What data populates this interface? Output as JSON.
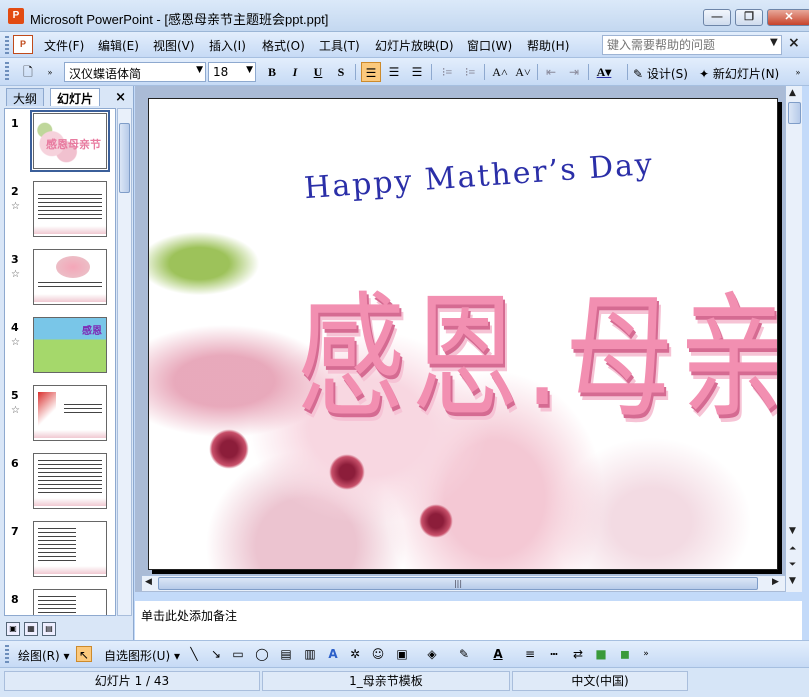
{
  "window": {
    "app_icon": "P",
    "title": "Microsoft PowerPoint - [感恩母亲节主题班会ppt.ppt]",
    "minimize": "—",
    "restore": "❐",
    "close": "✕"
  },
  "menu": {
    "doc_icon": "P",
    "items": [
      "文件(F)",
      "编辑(E)",
      "视图(V)",
      "插入(I)",
      "格式(O)",
      "工具(T)",
      "幻灯片放映(D)",
      "窗口(W)",
      "帮助(H)"
    ],
    "help_placeholder": "键入需要帮助的问题",
    "help_arrow": "▼",
    "close_doc": "×"
  },
  "toolbar": {
    "font_name": "汉仪蝶语体简",
    "font_size": "18",
    "bold": "B",
    "italic": "I",
    "underline": "U",
    "shadow": "S",
    "design_label": "设计(S)",
    "new_slide_label": "新幻灯片(N)"
  },
  "left_panel": {
    "tab_outline": "大纲",
    "tab_slides": "幻灯片",
    "close": "×",
    "thumbnails": [
      {
        "num": "1",
        "star": "",
        "label": "感恩母亲节"
      },
      {
        "num": "2",
        "star": "☆"
      },
      {
        "num": "3",
        "star": "☆"
      },
      {
        "num": "4",
        "star": "☆",
        "label": "感恩"
      },
      {
        "num": "5",
        "star": "☆"
      },
      {
        "num": "6",
        "star": ""
      },
      {
        "num": "7",
        "star": ""
      },
      {
        "num": "8",
        "star": ""
      }
    ]
  },
  "slide": {
    "subtitle": "Happy Mather’s Day",
    "title": "感恩.母亲节"
  },
  "notes": {
    "placeholder": "单击此处添加备注"
  },
  "draw_toolbar": {
    "draw_label": "绘图(R)",
    "autoshapes_label": "自选图形(U)"
  },
  "status": {
    "slide_info": "幻灯片 1 / 43",
    "template": "1_母亲节模板",
    "language": "中文(中国)"
  },
  "colors": {
    "title_pink": "#f28fb1",
    "subtitle_blue": "#2b2fa8",
    "active_orange": "#fbc97d"
  }
}
